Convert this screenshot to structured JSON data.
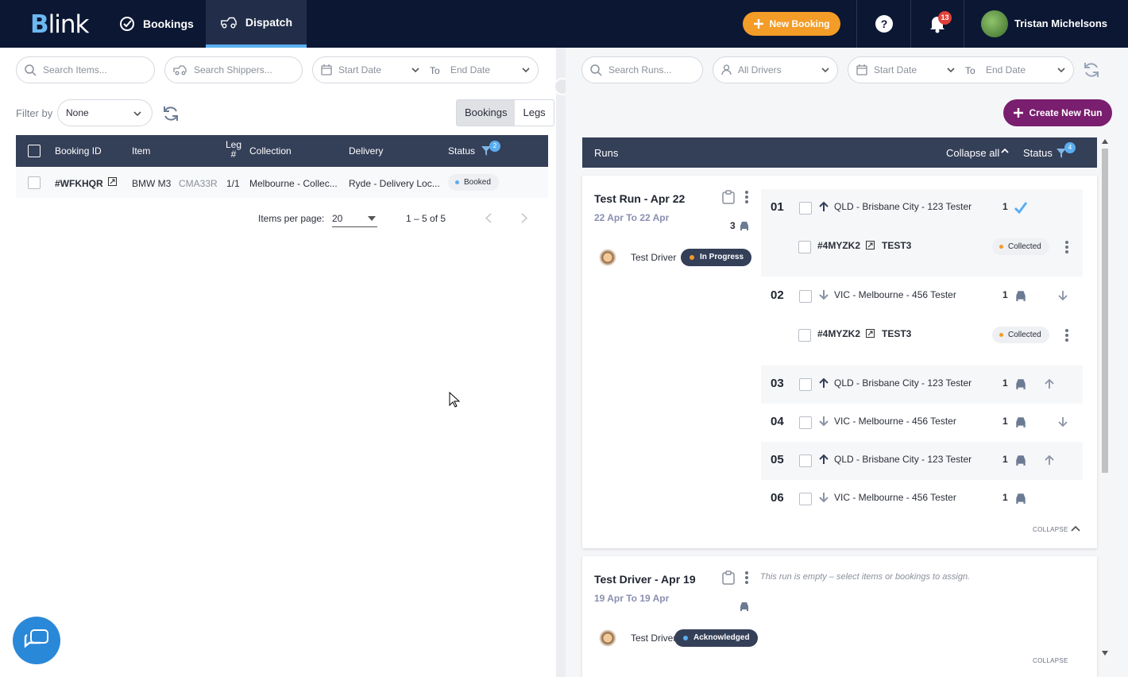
{
  "app": {
    "logo_text": "link",
    "logo_letter": "B"
  },
  "nav": {
    "bookings": "Bookings",
    "dispatch": "Dispatch"
  },
  "header": {
    "new_booking": "New Booking",
    "help": "?",
    "notif_count": "13",
    "user": "Tristan Michelsons"
  },
  "left": {
    "search_items": "Search Items...",
    "search_shippers": "Search Shippers...",
    "start_date": "Start Date",
    "to": "To",
    "end_date": "End Date",
    "filter_by": "Filter by",
    "filter_value": "None",
    "toggle": [
      "Bookings",
      "Legs"
    ],
    "columns": {
      "booking_id": "Booking ID",
      "item": "Item",
      "leg": "Leg #",
      "collection": "Collection",
      "delivery": "Delivery",
      "status": "Status",
      "status_filter_count": "2"
    },
    "rows": [
      {
        "id": "#WFKHQR",
        "item": "BMW M3",
        "rego": "CMA33R",
        "leg": "1/1",
        "collection": "Melbourne - Collec...",
        "delivery": "Ryde - Delivery Loc...",
        "status": "Booked"
      }
    ],
    "pager": {
      "items_per_page": "Items per page:",
      "size": "20",
      "range": "1 – 5 of 5"
    }
  },
  "right": {
    "search_runs": "Search Runs...",
    "all_drivers": "All Drivers",
    "start_date": "Start Date",
    "to": "To",
    "end_date": "End Date",
    "create_run": "Create New Run",
    "runs_label": "Runs",
    "collapse_all": "Collapse all",
    "status": "Status",
    "status_filter_count": "4",
    "runs": [
      {
        "title": "Test Run - Apr 22",
        "dates": "22 Apr To 22 Apr",
        "vehicles": "3",
        "driver": "Test Driver",
        "state": "In Progress",
        "stops": [
          {
            "num": "01",
            "addr": "QLD - Brisbane City - 123 Tester",
            "qty": "1"
          },
          {
            "num": "02",
            "addr": "VIC - Melbourne - 456 Tester",
            "qty": "1"
          },
          {
            "num": "03",
            "addr": "QLD - Brisbane City - 123 Tester",
            "qty": "1"
          },
          {
            "num": "04",
            "addr": "VIC - Melbourne - 456 Tester",
            "qty": "1"
          },
          {
            "num": "05",
            "addr": "QLD - Brisbane City - 123 Tester",
            "qty": "1"
          },
          {
            "num": "06",
            "addr": "VIC - Melbourne - 456 Tester",
            "qty": "1"
          }
        ],
        "items": [
          {
            "id": "#4MYZK2",
            "name": "TEST3",
            "status": "Collected"
          },
          {
            "id": "#4MYZK2",
            "name": "TEST3",
            "status": "Collected"
          }
        ],
        "collapse": "COLLAPSE"
      },
      {
        "title": "Test Driver - Apr 19",
        "dates": "19 Apr To 19 Apr",
        "driver": "Test Driver",
        "state": "Acknowledged",
        "empty": "This run is empty – select items or bookings to assign.",
        "collapse": "COLLAPSE"
      }
    ]
  },
  "colors": {
    "nav_bg": "#0c1733",
    "header_row": "#343f58",
    "accent_orange": "#f39c27",
    "accent_purple": "#7a1e6f",
    "accent_blue": "#5aaef0"
  }
}
